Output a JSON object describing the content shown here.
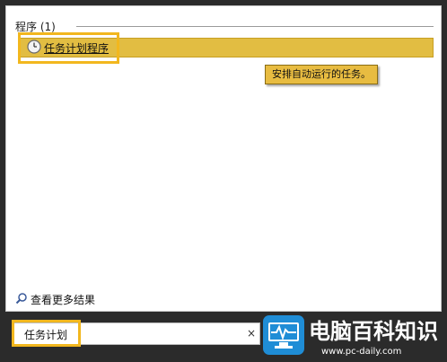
{
  "results": {
    "header": "程序 (1)",
    "items": [
      {
        "label": "任务计划程序",
        "icon": "clock-icon",
        "tooltip": "安排自动运行的任务。"
      }
    ]
  },
  "see_more": {
    "label": "查看更多结果",
    "icon": "search-icon"
  },
  "search": {
    "value": "任务计划",
    "clear_glyph": "×"
  },
  "watermark": {
    "title": "电脑百科知识",
    "url": "www.pc-daily.com",
    "icon": "monitor-logo-icon"
  },
  "colors": {
    "accent_highlight": "#f2b71e",
    "selection": "#e2bd42"
  }
}
